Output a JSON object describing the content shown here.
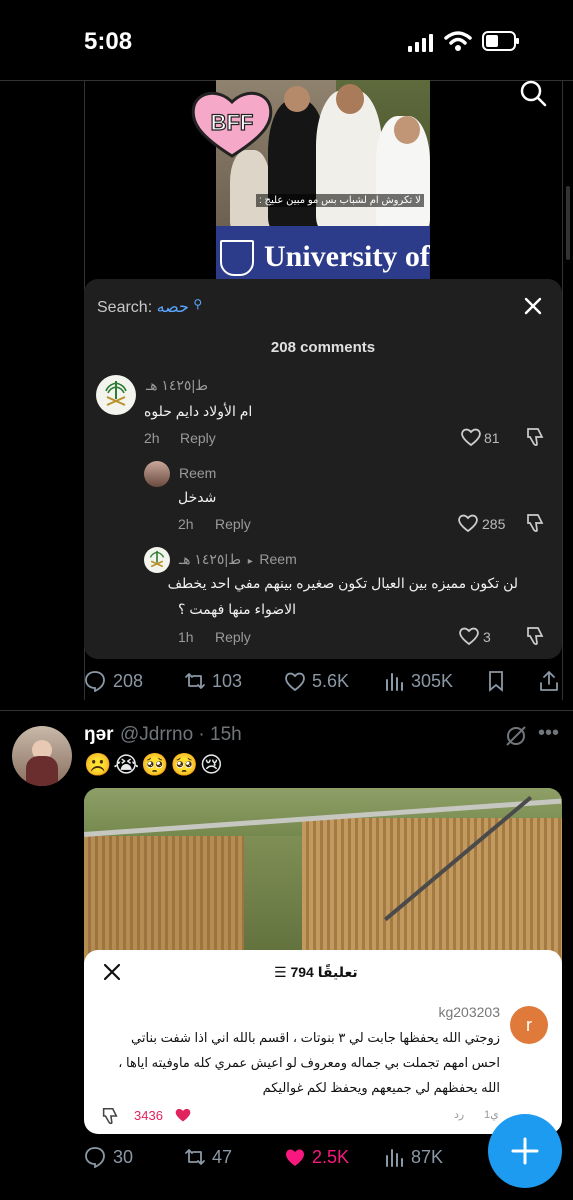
{
  "status_bar": {
    "time": "5:08"
  },
  "tweet1": {
    "image": {
      "badge": "BFF",
      "caption": "لا تكروش ام لشباب بس مو مبين عليج :",
      "banner_text": "University of"
    },
    "comments_overlay": {
      "search_label": "Search:",
      "search_term": "حصه",
      "count_label": "208 comments",
      "comments": [
        {
          "username": "ط|١٤٢٥ هـ",
          "text": "ام الأولاد دايم حلوه",
          "time": "2h",
          "reply": "Reply",
          "likes": "81"
        },
        {
          "username": "Reem",
          "text": "شدخل",
          "time": "2h",
          "reply": "Reply",
          "likes": "285"
        },
        {
          "username": "ط|١٤٢٥ هـ",
          "reply_to": "Reem",
          "text_line1": "لن تكون مميزه بين العيال تكون صغيره بينهم مفي احد يخطف",
          "text_line2": "الاضواء منها فهمت ؟",
          "time": "1h",
          "reply": "Reply",
          "likes": "3"
        }
      ]
    },
    "actions": {
      "replies": "208",
      "retweets": "103",
      "likes": "5.6K",
      "views": "305K"
    }
  },
  "tweet2": {
    "name": "ŋər",
    "handle": "@Jdrrno · 15h",
    "emojis": "☹️😭🥺🥺😢",
    "comments_overlay": {
      "title": "794 تعليقًا",
      "username": "kg203203",
      "avatar_letter": "r",
      "line1": "زوجتي الله يحفظها جابت لي ٣ بنوتات ، اقسم بالله اني اذا شفت بناتي",
      "line2": "احس امهم تجملت بي جماله ومعروف لو اعيش عمري كله ماوفيته اياها ،",
      "line3": "الله يحفظهم لي جميعهم ويحفظ لكم غواليكم",
      "time": "1ي",
      "reply": "رد",
      "likes": "3436"
    },
    "actions": {
      "replies": "30",
      "retweets": "47",
      "likes": "2.5K",
      "views": "87K"
    }
  },
  "colors": {
    "accent": "#1d9bf0",
    "like_pink": "#f91880"
  }
}
